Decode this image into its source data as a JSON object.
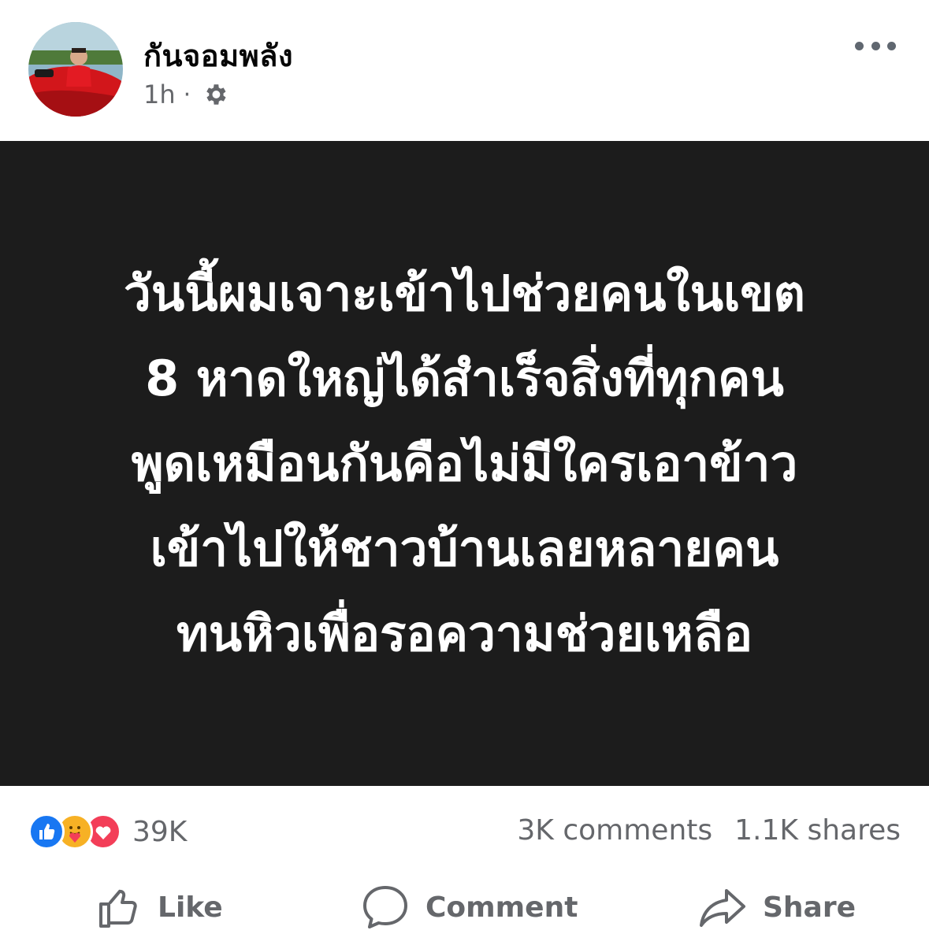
{
  "post": {
    "author": "กันจอมพลัง",
    "time": "1h",
    "separator": "·",
    "privacy_icon": "gear-icon",
    "more_icon": "more-options-icon"
  },
  "image_text": {
    "lines": [
      "วันนี้ผมเจาะเข้าไปช่วยคนในเขต",
      "8 หาดใหญ่ได้สำเร็จสิ่งที่ทุกคน",
      "พูดเหมือนกันคือไม่มีใครเอาข้าว",
      "เข้าไปให้ชาวบ้านเลยหลายคน",
      "ทนหิวเพื่อรอความช่วยเหลือ"
    ]
  },
  "stats": {
    "reaction_icons": [
      "like-reaction-icon",
      "care-reaction-icon",
      "love-reaction-icon"
    ],
    "reactions": "39K",
    "comments": "3K comments",
    "shares": "1.1K shares"
  },
  "actions": {
    "like": "Like",
    "comment": "Comment",
    "share": "Share"
  },
  "colors": {
    "image_bg": "#1c1c1c",
    "secondary_text": "#65676b",
    "like_blue": "#1877f2",
    "love_red": "#f33e58",
    "care_yellow": "#f7b125"
  }
}
